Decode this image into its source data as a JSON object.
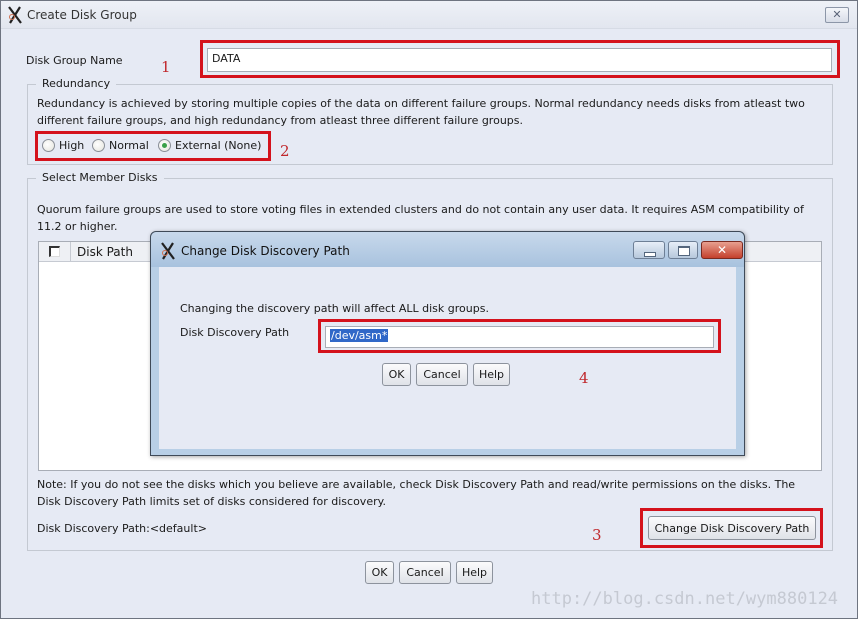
{
  "window": {
    "title": "Create Disk Group",
    "close_glyph": "✕"
  },
  "disk_group_name": {
    "label": "Disk Group Name",
    "value": "DATA"
  },
  "redundancy": {
    "title": "Redundancy",
    "description_line1": "Redundancy is achieved by storing multiple copies of the data on different failure groups. Normal redundancy needs disks from atleast two",
    "description_line2": "different failure groups, and high redundancy from atleast three different failure groups.",
    "options": [
      {
        "label": "High",
        "checked": false
      },
      {
        "label": "Normal",
        "checked": false
      },
      {
        "label": "External (None)",
        "checked": true
      }
    ]
  },
  "member_disks": {
    "title": "Select Member Disks",
    "description_line1": "Quorum failure groups are used to store voting files in extended clusters and do not contain any user data. It requires ASM compatibility of",
    "description_line2": "11.2 or higher.",
    "table": {
      "columns": [
        "",
        "Disk Path"
      ],
      "rows": []
    },
    "note_line1": "Note: If you do not see the disks which you believe are available, check Disk Discovery Path and read/write permissions on the disks. The",
    "note_line2": "Disk Discovery Path limits set of disks considered for discovery.",
    "discovery_path_text": "Disk Discovery Path:<default>",
    "change_button": "Change Disk Discovery Path"
  },
  "footer": {
    "ok": "OK",
    "cancel": "Cancel",
    "help": "Help"
  },
  "sub_dialog": {
    "title": "Change Disk Discovery Path",
    "message": "Changing the discovery path will affect ALL disk groups.",
    "path_label": "Disk Discovery Path",
    "path_value": "/dev/asm*",
    "ok": "OK",
    "cancel": "Cancel",
    "help": "Help"
  },
  "annotations": {
    "step1": "1",
    "step2": "2",
    "step3": "3",
    "step4": "4",
    "highlight_color": "#d4121c"
  },
  "watermark": "http://blog.csdn.net/wym880124"
}
